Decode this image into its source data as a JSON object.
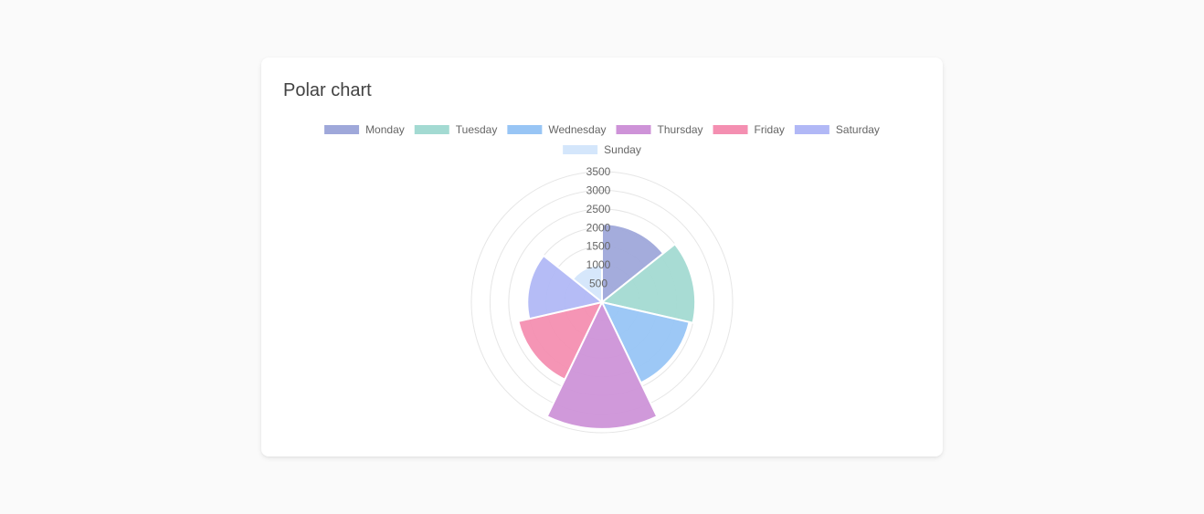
{
  "card": {
    "title": "Polar chart"
  },
  "chart_data": {
    "type": "polarArea",
    "categories": [
      "Monday",
      "Tuesday",
      "Wednesday",
      "Thursday",
      "Friday",
      "Saturday",
      "Sunday"
    ],
    "values": [
      2100,
      2500,
      2400,
      3400,
      2300,
      2000,
      1000
    ],
    "colors": [
      "#9fa8da",
      "#a3dad2",
      "#98c5f5",
      "#ce93d8",
      "#f48fb1",
      "#b1b8f6",
      "#d4e6fb"
    ],
    "rlim": [
      0,
      3500
    ],
    "ticks": [
      500,
      1000,
      1500,
      2000,
      2500,
      3000,
      3500
    ],
    "grid": true,
    "legend_position": "top"
  }
}
